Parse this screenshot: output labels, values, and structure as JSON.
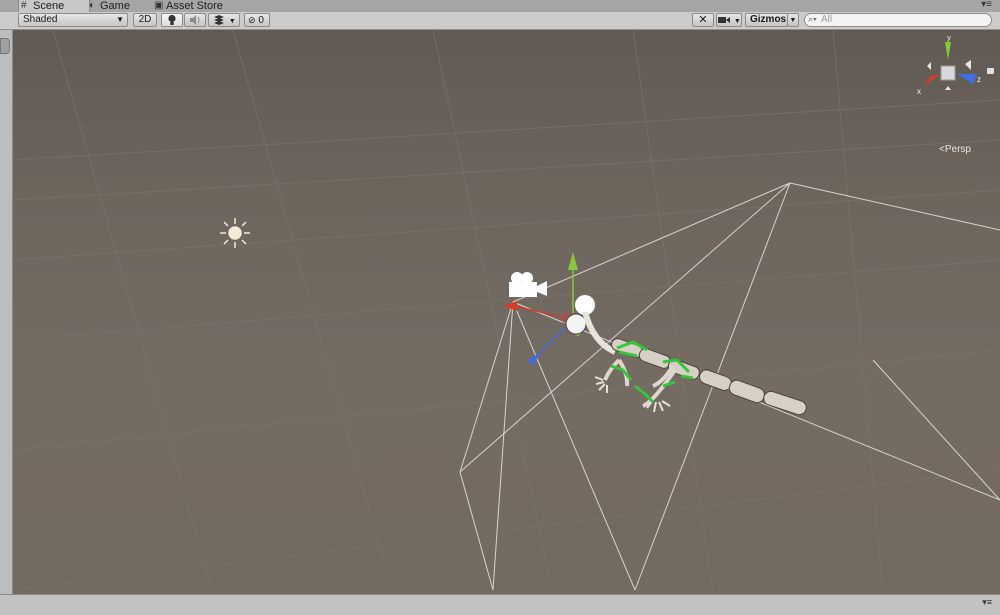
{
  "tabs": [
    {
      "label": "Scene",
      "icon": "grid-icon",
      "active": true
    },
    {
      "label": "Game",
      "icon": "pacman-icon",
      "active": false
    },
    {
      "label": "Asset Store",
      "icon": "store-icon",
      "active": false
    }
  ],
  "toolbar": {
    "draw_mode": "Shaded",
    "mode_2d": "2D",
    "hidden_count": "0",
    "gizmos_label": "Gizmos",
    "search_placeholder": "All"
  },
  "gizmo": {
    "y_label": "y",
    "x_label": "x",
    "z_label": "z",
    "projection": "Persp"
  },
  "colors": {
    "x_axis": "#d83b2b",
    "y_axis": "#86c83a",
    "z_axis": "#3f6fe0",
    "frustum": "#d9d4cf",
    "bones": "#36c43a"
  }
}
